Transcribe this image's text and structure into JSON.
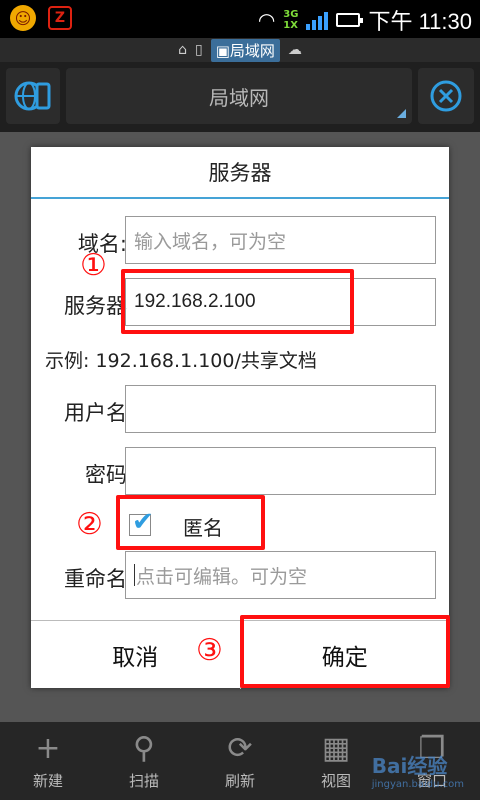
{
  "status_bar": {
    "app_icon_1": "smiley-app-icon",
    "app_icon_2_text": "Z",
    "network_type_top": "3G",
    "network_type_bottom": "1X",
    "time": "下午 11:30"
  },
  "breadcrumb": {
    "current": "局域网"
  },
  "toolbar": {
    "title": "局域网"
  },
  "dialog": {
    "title": "服务器",
    "domain_label": "域名:",
    "domain_placeholder": "输入域名，可为空",
    "server_label": "服务器",
    "server_value": "192.168.2.100",
    "example_label": "示例:",
    "example_value": "192.168.1.100/共享文档",
    "username_label": "用户名",
    "username_value": "",
    "password_label": "密码",
    "password_value": "",
    "anonymous_label": "匿名",
    "anonymous_checked": true,
    "rename_label": "重命名",
    "rename_placeholder": "点击可编辑。可为空",
    "cancel_label": "取消",
    "ok_label": "确定"
  },
  "annotations": {
    "step1": "①",
    "step2": "②",
    "step3": "③",
    "color": "#ff1010"
  },
  "bottom_nav": {
    "items": [
      {
        "label": "新建",
        "icon": "plus-icon"
      },
      {
        "label": "扫描",
        "icon": "search-icon"
      },
      {
        "label": "刷新",
        "icon": "refresh-icon"
      },
      {
        "label": "视图",
        "icon": "grid-icon"
      },
      {
        "label": "窗口",
        "icon": "windows-icon"
      }
    ]
  },
  "watermark": {
    "main": "Bai经验",
    "sub": "jingyan.baidu.com"
  },
  "colors": {
    "accent": "#45a3d6",
    "annotation": "#ff1010"
  }
}
